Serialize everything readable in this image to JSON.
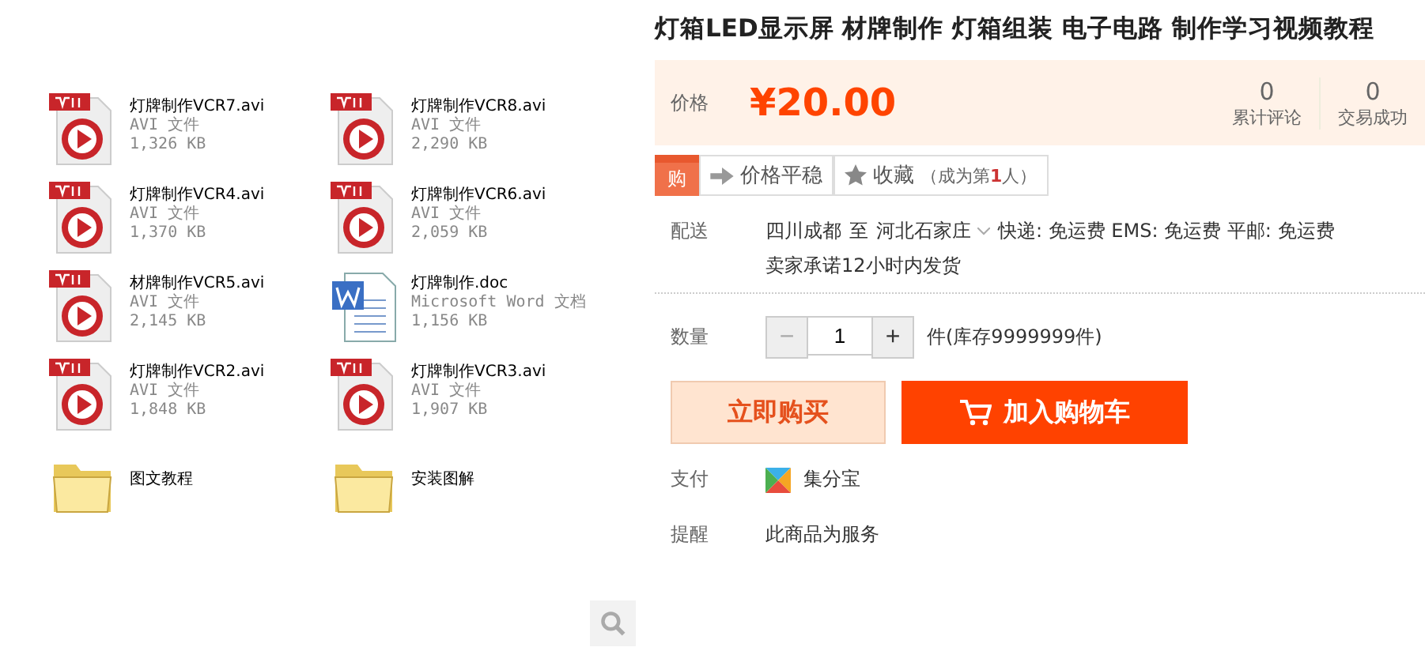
{
  "files": [
    {
      "kind": "avi",
      "name": "灯牌制作VCR7.avi",
      "type": "AVI 文件",
      "size": "1,326 KB"
    },
    {
      "kind": "avi",
      "name": "灯牌制作VCR8.avi",
      "type": "AVI 文件",
      "size": "2,290 KB"
    },
    {
      "kind": "avi",
      "name": "灯牌制作VCR4.avi",
      "type": "AVI 文件",
      "size": "1,370 KB"
    },
    {
      "kind": "avi",
      "name": "灯牌制作VCR6.avi",
      "type": "AVI 文件",
      "size": "2,059 KB"
    },
    {
      "kind": "avi",
      "name": "材牌制作VCR5.avi",
      "type": "AVI 文件",
      "size": "2,145 KB"
    },
    {
      "kind": "doc",
      "name": "灯牌制作.doc",
      "type": "Microsoft Word 文档",
      "size": "1,156 KB"
    },
    {
      "kind": "avi",
      "name": "灯牌制作VCR2.avi",
      "type": "AVI 文件",
      "size": "1,848 KB"
    },
    {
      "kind": "avi",
      "name": "灯牌制作VCR3.avi",
      "type": "AVI 文件",
      "size": "1,907 KB"
    },
    {
      "kind": "folder",
      "name": "图文教程"
    },
    {
      "kind": "folder",
      "name": "安装图解"
    }
  ],
  "product": {
    "title": "灯箱LED显示屏 材牌制作 灯箱组装 电子电路 制作学习视频教程",
    "price_label": "价格",
    "price": "¥20.00",
    "stats": [
      {
        "value": "0",
        "label": "累计评论"
      },
      {
        "value": "0",
        "label": "交易成功"
      }
    ],
    "buy_badge": "购",
    "price_trend": "价格平稳",
    "favorite": "收藏",
    "favorite_note": "（成为第**1**人）",
    "shipping_label": "配送",
    "shipping_from": "四川成都",
    "shipping_to_word": "至",
    "shipping_to": "河北石家庄",
    "shipping_fees": "快递: 免运费 EMS: 免运费 平邮: 免运费",
    "shipping_promise": "卖家承诺12小时内发货",
    "quantity_label": "数量",
    "quantity_minus": "−",
    "quantity": "1",
    "quantity_plus": "+",
    "stock": "件(库存9999999件)",
    "buy_now": "立即购买",
    "add_to_cart": "加入购物车",
    "payment_label": "支付",
    "payment_method": "集分宝",
    "reminder_label": "提醒",
    "reminder": "此商品为服务"
  }
}
